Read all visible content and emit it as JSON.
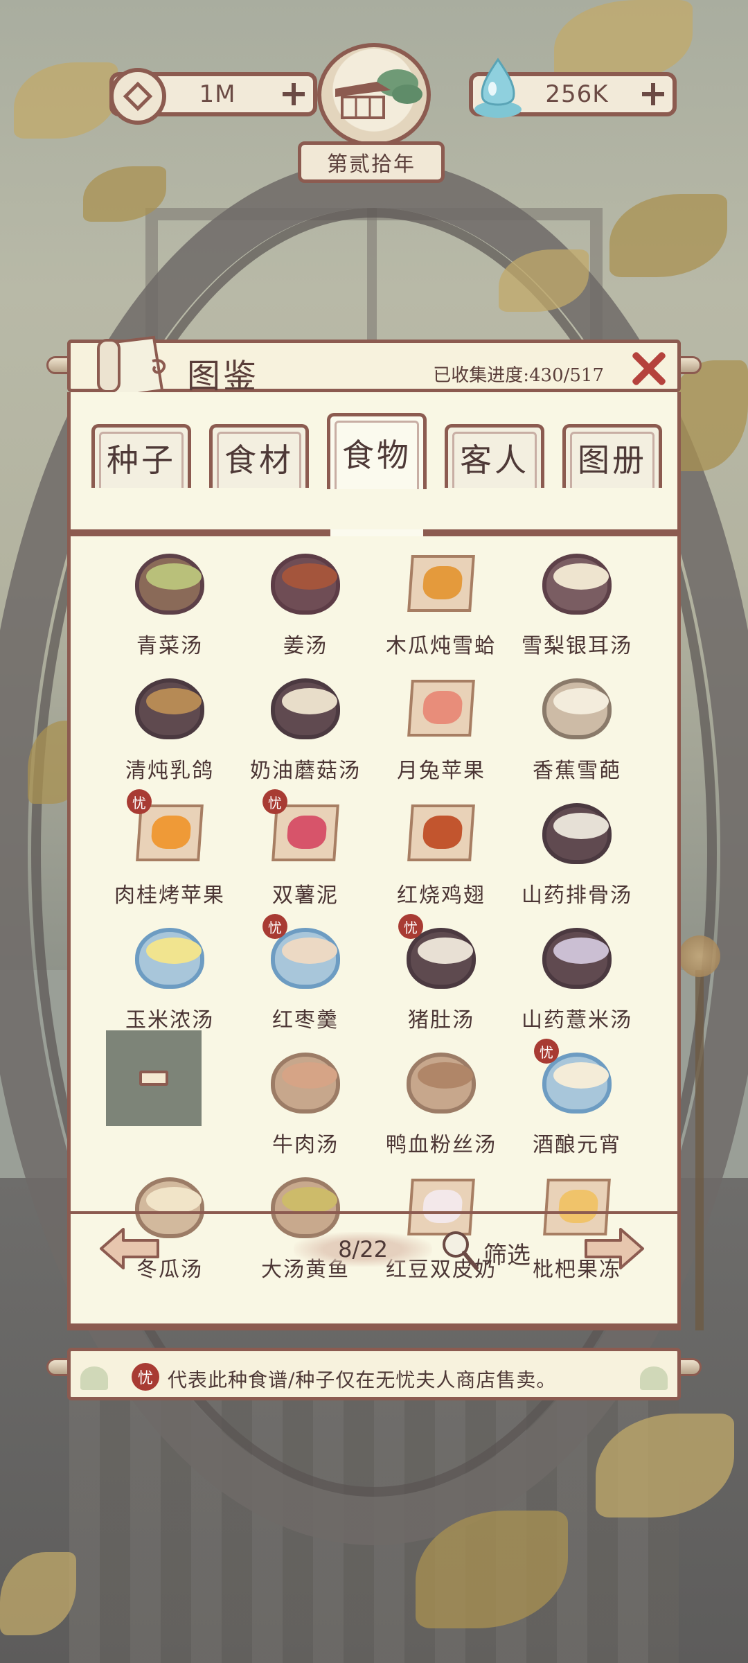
{
  "hud": {
    "coins": "1M",
    "water": "256K",
    "year": "第贰拾年"
  },
  "panel": {
    "title": "图鉴",
    "progress": "已收集进度:430/517"
  },
  "tabs": [
    {
      "label": "种子"
    },
    {
      "label": "食材"
    },
    {
      "label": "食物"
    },
    {
      "label": "客人"
    },
    {
      "label": "图册"
    }
  ],
  "active_tab": "食物",
  "items": [
    {
      "name": "青菜汤",
      "icon": "green-vegetable-soup-icon",
      "exclusive": false
    },
    {
      "name": "姜汤",
      "icon": "ginger-soup-icon",
      "exclusive": false
    },
    {
      "name": "木瓜炖雪蛤",
      "icon": "papaya-snow-frog-icon",
      "exclusive": false
    },
    {
      "name": "雪梨银耳汤",
      "icon": "pear-fungus-soup-icon",
      "exclusive": false
    },
    {
      "name": "清炖乳鸽",
      "icon": "stewed-pigeon-icon",
      "exclusive": false
    },
    {
      "name": "奶油蘑菇汤",
      "icon": "mushroom-soup-icon",
      "exclusive": false
    },
    {
      "name": "月兔苹果",
      "icon": "rabbit-apple-icon",
      "exclusive": false
    },
    {
      "name": "香蕉雪葩",
      "icon": "banana-sorbet-icon",
      "exclusive": false
    },
    {
      "name": "肉桂烤苹果",
      "icon": "cinnamon-apple-icon",
      "exclusive": true
    },
    {
      "name": "双薯泥",
      "icon": "mashed-potato-icon",
      "exclusive": true
    },
    {
      "name": "红烧鸡翅",
      "icon": "braised-wings-icon",
      "exclusive": false
    },
    {
      "name": "山药排骨汤",
      "icon": "yam-rib-soup-icon",
      "exclusive": false
    },
    {
      "name": "玉米浓汤",
      "icon": "corn-soup-icon",
      "exclusive": false
    },
    {
      "name": "红枣羹",
      "icon": "red-date-soup-icon",
      "exclusive": true
    },
    {
      "name": "猪肚汤",
      "icon": "pork-tripe-soup-icon",
      "exclusive": true
    },
    {
      "name": "山药薏米汤",
      "icon": "yam-barley-soup-icon",
      "exclusive": false
    },
    {
      "name": "",
      "icon": "locked-dish-icon",
      "exclusive": false,
      "locked": true
    },
    {
      "name": "牛肉汤",
      "icon": "beef-soup-icon",
      "exclusive": false
    },
    {
      "name": "鸭血粉丝汤",
      "icon": "duck-blood-soup-icon",
      "exclusive": false
    },
    {
      "name": "酒酿元宵",
      "icon": "rice-ball-icon",
      "exclusive": true
    },
    {
      "name": "冬瓜汤",
      "icon": "winter-melon-soup-icon",
      "exclusive": false
    },
    {
      "name": "大汤黄鱼",
      "icon": "yellow-croaker-icon",
      "exclusive": false
    },
    {
      "name": "红豆双皮奶",
      "icon": "red-bean-pudding-icon",
      "exclusive": false
    },
    {
      "name": "枇杷果冻",
      "icon": "loquat-jelly-icon",
      "exclusive": false
    }
  ],
  "exclusive_badge_char": "忧",
  "pager": {
    "page": "8/22",
    "filter_label": "筛选"
  },
  "notice": {
    "text": "代表此种食谱/种子仅在无忧夫人商店售卖。"
  },
  "colors": {
    "border": "#8c5b50",
    "paper": "#f9f7e4",
    "text": "#4e3937",
    "badge": "#a83b33",
    "close": "#b5423c"
  }
}
